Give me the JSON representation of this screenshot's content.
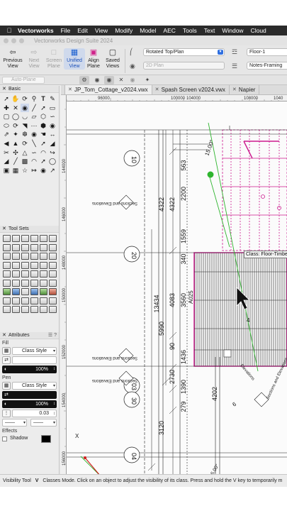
{
  "menubar": {
    "app_name": "Vectorworks",
    "items": [
      "File",
      "Edit",
      "View",
      "Modify",
      "Model",
      "AEC",
      "Tools",
      "Text",
      "Window",
      "Cloud"
    ]
  },
  "window": {
    "title": "Vectorworks Design Suite 2024"
  },
  "toolbar": {
    "previous_view": "Previous\nView",
    "next_view": "Next\nView",
    "screen_plane": "Screen\nPlane",
    "unified_view": "Unified\nView",
    "align_plane": "Align\nPlane",
    "saved_views": "Saved\nViews",
    "view_select": "Rotated Top/Plan",
    "render_mode": "2D Plan",
    "layer_select": "Floor-1",
    "class_select": "Notes-Framing"
  },
  "row2": {
    "auto_plane": "Auto-Plane"
  },
  "palettes": {
    "basic": {
      "title": "Basic"
    },
    "tool_sets": {
      "title": "Tool Sets"
    },
    "attributes": {
      "title": "Attributes",
      "fill_label": "Fill",
      "fill_style": "Class Style",
      "fill_opacity": "100%",
      "pen_label": "Pen",
      "pen_style": "Class Style",
      "pen_opacity": "100%",
      "line_weight": "0.03",
      "effects_label": "Effects",
      "shadow_label": "Shadow"
    }
  },
  "tabs": [
    {
      "label": "JP_Tom_Cottage_v2024.vwx"
    },
    {
      "label": "Spash Screen v2024.vwx"
    },
    {
      "label": "Napier"
    }
  ],
  "rulers": {
    "h_ticks": [
      "96000",
      "100000",
      "104000",
      "108000",
      "1040"
    ],
    "v_ticks": [
      "144000",
      "146000",
      "148000",
      "150000",
      "152000",
      "154000",
      "156000"
    ]
  },
  "drawing": {
    "dims_left": [
      "563",
      "4322",
      "4322",
      "2200",
      "1559",
      "340",
      "4083",
      "3560",
      "13434",
      "5990",
      "90",
      "1436",
      "2730",
      "1390",
      "279",
      "4202",
      "3120"
    ],
    "grid_bubbles": [
      "10",
      "20",
      "03",
      "30",
      "04"
    ],
    "section_labels": [
      "Sections and Elevations",
      "Sections and Elevations",
      "Sections and Elevations",
      "Sections and Elevations"
    ],
    "angle_label": "15.00°",
    "angle_label_2": "15.00°",
    "ref_code": "A025",
    "rotated_marker": "A",
    "tooltip": "Class: Floor-Timbe",
    "x_axis": "X",
    "y_axis": "Y",
    "side_note": "6",
    "side_note_2": "4",
    "elevation_text": "Elevations"
  },
  "statusbar": {
    "tool": "Visibility Tool",
    "key": "V",
    "message": "Classes Mode. Click on an object to adjust the visibility of its class. Press and hold the V key to temporarily m"
  },
  "colors": {
    "accent": "#2f6fe0",
    "magenta": "#cc1a8e",
    "green": "#2fb52f",
    "dark_hatch": "#3a3a3a"
  }
}
